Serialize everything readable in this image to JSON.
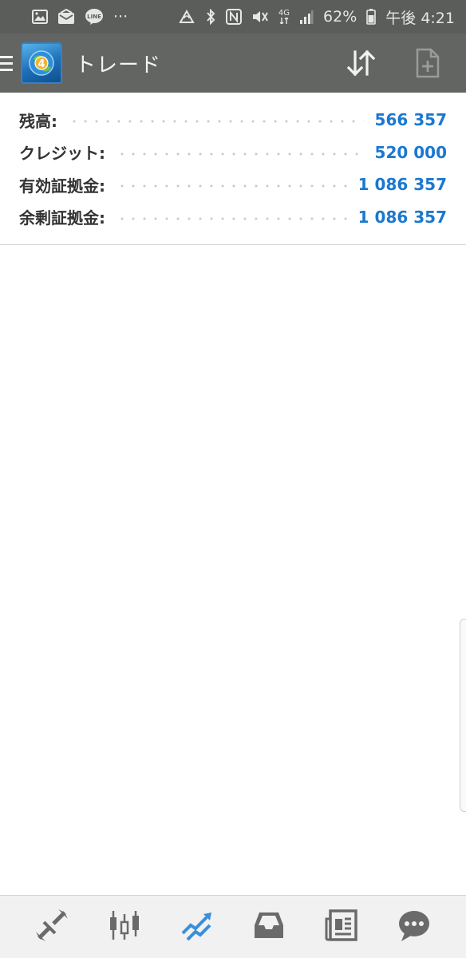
{
  "status_bar": {
    "icons_left": [
      "gallery-icon",
      "mail-icon",
      "line-app-icon",
      "more-icon"
    ],
    "more_text": "···",
    "icons_right": [
      "sync-icon",
      "bluetooth-icon",
      "nfc-icon",
      "mute-icon",
      "network-4g-icon",
      "signal-icon",
      "battery-icon"
    ],
    "network_label": "4G",
    "battery": "62%",
    "time": "午後 4:21"
  },
  "app_bar": {
    "title": "トレード",
    "icons": [
      "menu-icon",
      "metatrader-logo",
      "sort-arrows-icon",
      "new-order-icon"
    ],
    "brand_color": "#1a78d0"
  },
  "summary": {
    "rows": [
      {
        "label": "残高:",
        "value": "566 357"
      },
      {
        "label": "クレジット:",
        "value": "520 000"
      },
      {
        "label": "有効証拠金:",
        "value": "1 086 357"
      },
      {
        "label": "余剰証拠金:",
        "value": "1 086 357"
      }
    ],
    "value_color": "#1a78d0"
  },
  "bottom_nav": {
    "items": [
      {
        "name": "quotes",
        "icon": "quotes-arrows-icon",
        "active": false
      },
      {
        "name": "chart",
        "icon": "candlestick-icon",
        "active": false
      },
      {
        "name": "trade",
        "icon": "trade-trend-icon",
        "active": true
      },
      {
        "name": "history",
        "icon": "inbox-icon",
        "active": false
      },
      {
        "name": "news",
        "icon": "newspaper-icon",
        "active": false
      },
      {
        "name": "messages",
        "icon": "chat-icon",
        "active": false
      }
    ],
    "active_color": "#3a8fd8",
    "inactive_color": "#6a6a6a"
  }
}
